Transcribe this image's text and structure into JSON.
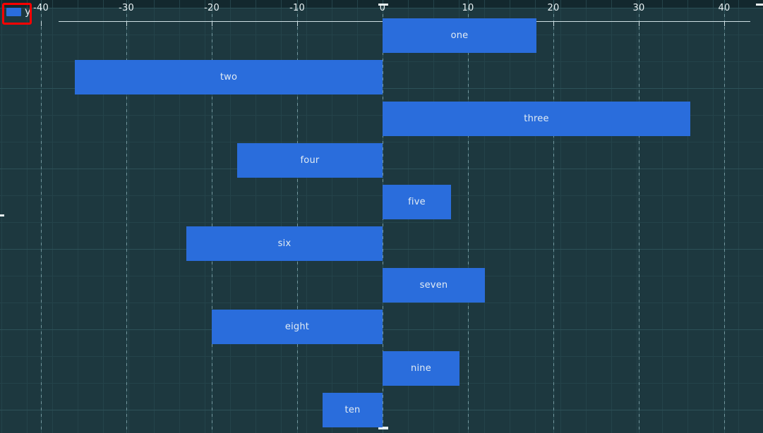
{
  "legend": {
    "entries": [
      {
        "label": "y",
        "color": "#2a6ddc",
        "swatch_name": "legend-color-swatch"
      }
    ],
    "position": "top-left"
  },
  "annotation": {
    "highlight_color": "#fe0000",
    "target": "legend"
  },
  "theme": {
    "background": "#1d383f",
    "header_band": "#13282e",
    "grid_minor": "#24434a",
    "grid_major": "#2d5158",
    "axis": "#cfe0e4",
    "bar": "#2a6ddc",
    "bar_label_text": "#e2ecf4",
    "tick_text": "#e8f1f3"
  },
  "chart_data": {
    "type": "bar",
    "orientation": "horizontal",
    "title": "",
    "subtitle": "",
    "xlabel": "",
    "ylabel": "",
    "categories": [
      "one",
      "two",
      "three",
      "four",
      "five",
      "six",
      "seven",
      "eight",
      "nine",
      "ten"
    ],
    "series": [
      {
        "name": "y",
        "color": "#2a6ddc",
        "values": [
          18,
          -36,
          36,
          -17,
          8,
          -23,
          12,
          -20,
          9,
          -7
        ]
      }
    ],
    "xlim": [
      -40,
      40
    ],
    "xticks": [
      -40,
      -30,
      -20,
      -10,
      0,
      10,
      20,
      30,
      40
    ],
    "xtick_labels": [
      "-40",
      "-30",
      "-20",
      "-10",
      "0",
      "10",
      "20",
      "30",
      "40"
    ],
    "yticks": [],
    "ytick_labels": [],
    "grid": true,
    "grid_axis": "both",
    "legend_position": "top-left",
    "bar_labels_inside": true,
    "baseline": 0
  }
}
